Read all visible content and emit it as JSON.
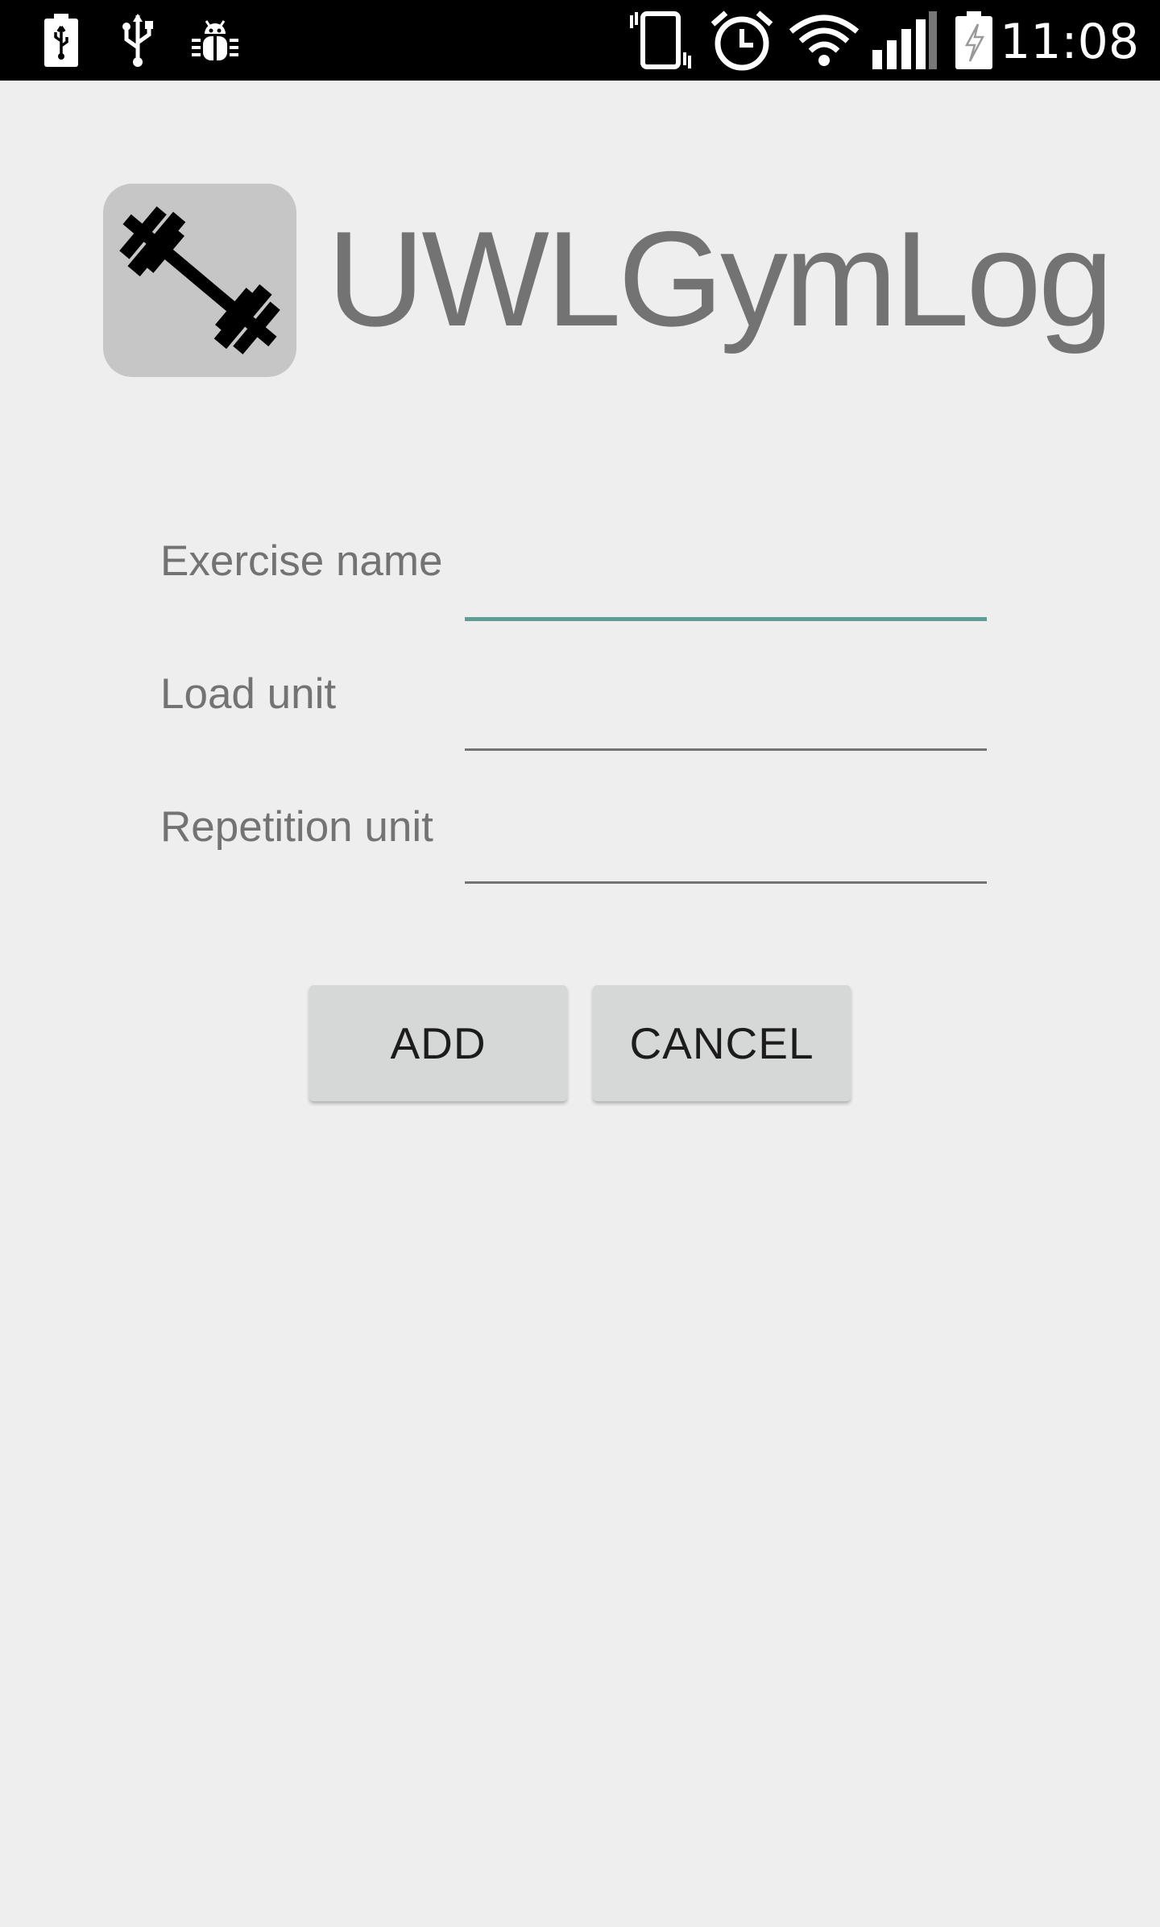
{
  "status_bar": {
    "time": "11:08",
    "left_icons": [
      "battery-charging-icon",
      "usb-icon",
      "android-debug-icon"
    ],
    "right_icons": [
      "vibrate-icon",
      "alarm-icon",
      "wifi-icon",
      "signal-icon",
      "battery-icon"
    ]
  },
  "header": {
    "logo_icon": "barbell-icon",
    "app_title": "UWLGymLog"
  },
  "form": {
    "exercise_name": {
      "label": "Exercise name",
      "value": "",
      "focused": true
    },
    "load_unit": {
      "label": "Load unit",
      "value": ""
    },
    "repetition_unit": {
      "label": "Repetition unit",
      "value": ""
    }
  },
  "buttons": {
    "add_label": "ADD",
    "cancel_label": "CANCEL"
  },
  "colors": {
    "background": "#eeeeee",
    "status_bar": "#000000",
    "focus_accent": "#5f9e96",
    "text_secondary": "#737373",
    "button_bg": "#d6d7d7"
  }
}
